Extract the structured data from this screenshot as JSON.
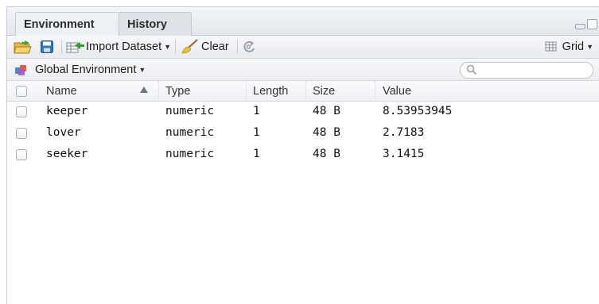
{
  "tabs": [
    {
      "label": "Environment",
      "active": true
    },
    {
      "label": "History",
      "active": false
    }
  ],
  "toolbar": {
    "open_icon": "open-folder-icon",
    "save_icon": "save-disk-icon",
    "import_label": "Import Dataset",
    "clear_label": "Clear",
    "refresh_icon": "refresh-icon",
    "view_mode_label": "Grid"
  },
  "env_selector": {
    "label": "Global Environment",
    "icon": "environment-cube-icon"
  },
  "search": {
    "placeholder": ""
  },
  "table": {
    "columns": [
      "Name",
      "Type",
      "Length",
      "Size",
      "Value"
    ],
    "sort_column": "Name",
    "rows": [
      {
        "name": "keeper",
        "type": "numeric",
        "length": "1",
        "size": "48 B",
        "value": "8.53953945"
      },
      {
        "name": "lover",
        "type": "numeric",
        "length": "1",
        "size": "48 B",
        "value": "2.7183"
      },
      {
        "name": "seeker",
        "type": "numeric",
        "length": "1",
        "size": "48 B",
        "value": "3.1415"
      }
    ]
  },
  "colors": {
    "accent_blue": "#2a78c4",
    "tab_bg": "#eef1f4",
    "border": "#c3c8cf"
  }
}
